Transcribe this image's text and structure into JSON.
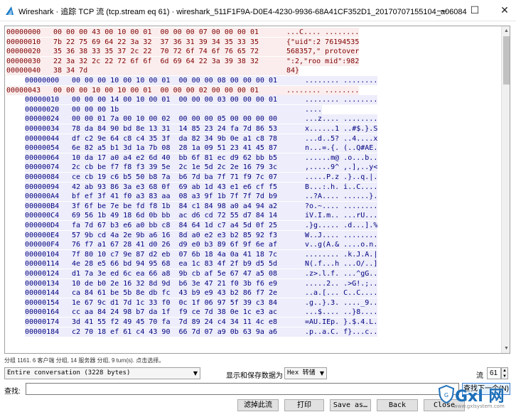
{
  "window": {
    "title": "Wireshark · 追踪 TCP 流 (tcp.stream eq 61) · wireshark_511F1F9A-D0E4-4230-9936-68A41CF352D1_20170707155104_a06084",
    "minimize_glyph": "—",
    "maximize_glyph": "☐",
    "close_glyph": "✕"
  },
  "colors": {
    "client_bg": "#fbeded",
    "client_fg": "#7f0000",
    "server_bg": "#ededfb",
    "server_fg": "#00007f"
  },
  "hex_rows": [
    {
      "dir": "client",
      "offset": "00000000",
      "hex": "00 00 00 43 00 10 00 01  00 00 00 07 00 00 00 01",
      "ascii": "...C.... ........"
    },
    {
      "dir": "client",
      "offset": "00000010",
      "hex": "7b 22 75 69 64 22 3a 32  37 36 31 39 34 35 33 35",
      "ascii": "{\"uid\":2 76194535"
    },
    {
      "dir": "client",
      "offset": "00000020",
      "hex": "35 36 38 33 35 37 2c 22  70 72 6f 74 6f 76 65 72",
      "ascii": "568357,\" protover"
    },
    {
      "dir": "client",
      "offset": "00000030",
      "hex": "22 3a 32 2c 22 72 6f 6f  6d 69 64 22 3a 39 38 32",
      "ascii": "\":2,\"roo mid\":982"
    },
    {
      "dir": "client",
      "offset": "00000040",
      "hex": "38 34 7d",
      "ascii": "84}"
    },
    {
      "dir": "server",
      "offset": "00000000",
      "hex": "00 00 00 10 00 10 00 01  00 00 00 08 00 00 00 01",
      "ascii": "........ ........"
    },
    {
      "dir": "client",
      "offset": "00000043",
      "hex": "00 00 00 10 00 10 00 01  00 00 00 02 00 00 00 01",
      "ascii": "........ ........"
    },
    {
      "dir": "server",
      "offset": "00000010",
      "hex": "00 00 00 14 00 10 00 01  00 00 00 03 00 00 00 01",
      "ascii": "........ ........"
    },
    {
      "dir": "server",
      "offset": "00000020",
      "hex": "00 00 00 1b",
      "ascii": "...."
    },
    {
      "dir": "server",
      "offset": "00000024",
      "hex": "00 00 01 7a 00 10 00 02  00 00 00 05 00 00 00 00",
      "ascii": "...z.... ........"
    },
    {
      "dir": "server",
      "offset": "00000034",
      "hex": "78 da 84 90 bd 8e 13 31  14 85 23 24 fa 7d 86 53",
      "ascii": "x......1 ..#$.}.S"
    },
    {
      "dir": "server",
      "offset": "00000044",
      "hex": "df c2 9e 64 c8 c4 35 3f  da 82 34 9b 0e a1 c8 78",
      "ascii": "...d..5? ..4....x"
    },
    {
      "dir": "server",
      "offset": "00000054",
      "hex": "6e 82 a5 b1 3d 1a 7b 08  28 1a 09 51 23 41 45 87",
      "ascii": "n...=.{. (..Q#AE."
    },
    {
      "dir": "server",
      "offset": "00000064",
      "hex": "10 da 17 a0 a4 e2 6d 40  bb 6f 81 ec d9 62 bb b5",
      "ascii": "......m@ .o...b.."
    },
    {
      "dir": "server",
      "offset": "00000074",
      "hex": "2c cb be f7 f8 f3 39 5e  2c 1e 5d 2c 2e 16 79 3c",
      "ascii": ",.....9^ ,.],..y<"
    },
    {
      "dir": "server",
      "offset": "00000084",
      "hex": "ce cb 19 c6 b5 50 b8 7a  b6 7d ba 7f 71 f9 7c 07",
      "ascii": ".....P.z .}..q.|."
    },
    {
      "dir": "server",
      "offset": "00000094",
      "hex": "42 ab 93 86 3a e3 68 0f  69 ab 1d 43 e1 e6 cf f5",
      "ascii": "B...:.h. i..C...."
    },
    {
      "dir": "server",
      "offset": "000000A4",
      "hex": "bf ef 3f 41 f0 a3 83 aa  08 a3 9f 1b 7f 7f 7d b9",
      "ascii": "..?A.... ......}."
    },
    {
      "dir": "server",
      "offset": "000000B4",
      "hex": "3f 6f be 7e be fd f8 1b  84 c1 84 98 a0 a4 94 a2",
      "ascii": "?o.~.... ........"
    },
    {
      "dir": "server",
      "offset": "000000C4",
      "hex": "69 56 1b 49 18 6d 0b bb  ac d6 cd 72 55 d7 84 14",
      "ascii": "iV.I.m.. ...rU..."
    },
    {
      "dir": "server",
      "offset": "000000D4",
      "hex": "fa 7d 67 b3 e6 a0 bb c8  84 64 1d c7 a4 5d 0f 25",
      "ascii": ".}g..... .d...].%"
    },
    {
      "dir": "server",
      "offset": "000000E4",
      "hex": "57 9b cd 4a 2e 9b a6 16  8d a0 e2 e3 b2 85 92 f3",
      "ascii": "W..J.... ........"
    },
    {
      "dir": "server",
      "offset": "000000F4",
      "hex": "76 f7 a1 67 28 41 d0 26  d9 e0 b3 89 6f 9f 6e af",
      "ascii": "v..g(A.& ....o.n."
    },
    {
      "dir": "server",
      "offset": "00000104",
      "hex": "7f 80 10 c7 9e 87 d2 eb  07 6b 18 4a 0a 41 18 7c",
      "ascii": "........ .k.J.A.|"
    },
    {
      "dir": "server",
      "offset": "00000114",
      "hex": "4e 28 e5 66 bd 94 95 68  ea 1c 83 4f 2f b9 d5 5d",
      "ascii": "N(.f...h ...O/..]"
    },
    {
      "dir": "server",
      "offset": "00000124",
      "hex": "d1 7a 3e ed 6c ea 66 a8  9b cb af 5e 67 47 a5 08",
      "ascii": ".z>.l.f. ...^gG.."
    },
    {
      "dir": "server",
      "offset": "00000134",
      "hex": "10 de b0 2e 16 32 8d 9d  b6 3e 47 21 f0 3b f6 e9",
      "ascii": ".....2.. .>G!.;.."
    },
    {
      "dir": "server",
      "offset": "00000144",
      "hex": "ca 84 61 be 5b 8e db fc  43 b9 e9 43 b2 86 f7 2e",
      "ascii": "..a.[... C..C...."
    },
    {
      "dir": "server",
      "offset": "00000154",
      "hex": "1e 67 9c d1 7d 1c 33 f0  0c 1f 06 97 5f 39 c3 84",
      "ascii": ".g..}.3. ...._9.."
    },
    {
      "dir": "server",
      "offset": "00000164",
      "hex": "cc aa 84 24 98 b7 da 1f  f9 ce 7d 38 0e 1c e3 ac",
      "ascii": "...$.... ..}8...."
    },
    {
      "dir": "server",
      "offset": "00000174",
      "hex": "3d 41 55 f2 49 45 70 fa  7d 89 24 c4 34 11 4c e8",
      "ascii": "=AU.IEp. }.$.4.L."
    },
    {
      "dir": "server",
      "offset": "00000184",
      "hex": "c2 70 18 ef 61 c4 43 90  66 7d 07 a9 0b 63 9a a6",
      "ascii": ".p..a.C. f}...c.."
    }
  ],
  "status_text": "分组 1161. 6 客户端 分组, 14 服务器 分组, 9 turn(s). 点击选择。",
  "conversation": {
    "value": "Entire conversation (3228 bytes)",
    "arrow": "▼"
  },
  "show_as": {
    "label": "显示和保存数据为",
    "value": "Hex 转储",
    "arrow": "▼"
  },
  "stream": {
    "label": "流",
    "value": "61",
    "up": "▲",
    "down": "▼"
  },
  "find": {
    "label": "查找:",
    "value": "",
    "button": "查找下一个(N)"
  },
  "buttons": {
    "filter_out": "滤掉此流",
    "print": "打印",
    "save_as": "Save as…",
    "back": "Back",
    "close": "Close"
  },
  "watermark": {
    "main": "Gxl 网",
    "sub": "www.gxlsystem.com"
  }
}
